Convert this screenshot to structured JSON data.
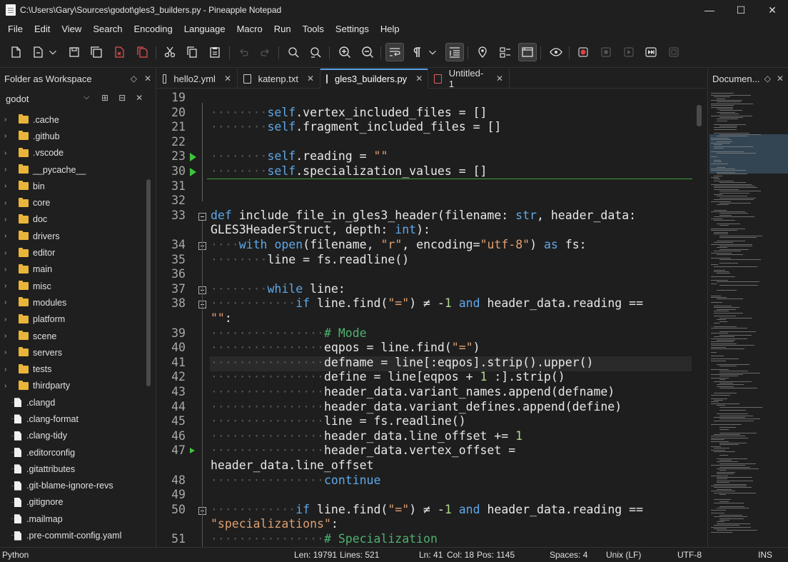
{
  "window": {
    "title": "C:\\Users\\Gary\\Sources\\godot\\gles3_builders.py - Pineapple Notepad",
    "minimize": "—",
    "maximize": "☐",
    "close": "✕"
  },
  "menu": [
    "File",
    "Edit",
    "View",
    "Search",
    "Encoding",
    "Language",
    "Macro",
    "Run",
    "Tools",
    "Settings",
    "Help"
  ],
  "left_panel": {
    "title": "Folder as Workspace",
    "folder": "godot",
    "tree": [
      {
        "name": ".cache",
        "type": "folder"
      },
      {
        "name": ".github",
        "type": "folder"
      },
      {
        "name": ".vscode",
        "type": "folder"
      },
      {
        "name": "__pycache__",
        "type": "folder"
      },
      {
        "name": "bin",
        "type": "folder"
      },
      {
        "name": "core",
        "type": "folder"
      },
      {
        "name": "doc",
        "type": "folder"
      },
      {
        "name": "drivers",
        "type": "folder"
      },
      {
        "name": "editor",
        "type": "folder"
      },
      {
        "name": "main",
        "type": "folder"
      },
      {
        "name": "misc",
        "type": "folder"
      },
      {
        "name": "modules",
        "type": "folder"
      },
      {
        "name": "platform",
        "type": "folder"
      },
      {
        "name": "scene",
        "type": "folder"
      },
      {
        "name": "servers",
        "type": "folder"
      },
      {
        "name": "tests",
        "type": "folder"
      },
      {
        "name": "thirdparty",
        "type": "folder"
      },
      {
        "name": ".clangd",
        "type": "file"
      },
      {
        "name": ".clang-format",
        "type": "file"
      },
      {
        "name": ".clang-tidy",
        "type": "file"
      },
      {
        "name": ".editorconfig",
        "type": "file"
      },
      {
        "name": ".gitattributes",
        "type": "file"
      },
      {
        "name": ".git-blame-ignore-revs",
        "type": "file"
      },
      {
        "name": ".gitignore",
        "type": "file"
      },
      {
        "name": ".mailmap",
        "type": "file"
      },
      {
        "name": ".pre-commit-config.yaml",
        "type": "file"
      }
    ]
  },
  "tabs": [
    {
      "label": "hello2.yml",
      "active": false,
      "unsaved": false
    },
    {
      "label": "katenp.txt",
      "active": false,
      "unsaved": false
    },
    {
      "label": "gles3_builders.py",
      "active": true,
      "unsaved": false
    },
    {
      "label": "Untitled-1",
      "active": false,
      "unsaved": true
    }
  ],
  "right_panel": {
    "title": "Documen..."
  },
  "status": {
    "language": "Python",
    "length": "Len: 19791",
    "lines": "Lines: 521",
    "line": "Ln: 41",
    "col": "Col: 18",
    "pos": "Pos: 1145",
    "spaces": "Spaces: 4",
    "eol": "Unix (LF)",
    "encoding": "UTF-8",
    "mode": "INS"
  },
  "code_lines": [
    {
      "num": "19",
      "text": ""
    },
    {
      "num": "20",
      "text": "        self.vertex_included_files = []"
    },
    {
      "num": "21",
      "text": "        self.fragment_included_files = []"
    },
    {
      "num": "22",
      "text": ""
    },
    {
      "num": "23",
      "text": "        self.reading = \"\""
    },
    {
      "num": "30",
      "text": "        self.specialization_values = []"
    },
    {
      "num": "31",
      "text": ""
    },
    {
      "num": "32",
      "text": ""
    },
    {
      "num": "33",
      "text": "def include_file_in_gles3_header(filename: str, header_data:"
    },
    {
      "num": "",
      "text": "GLES3HeaderStruct, depth: int):"
    },
    {
      "num": "34",
      "text": "    with open(filename, \"r\", encoding=\"utf-8\") as fs:"
    },
    {
      "num": "35",
      "text": "        line = fs.readline()"
    },
    {
      "num": "36",
      "text": ""
    },
    {
      "num": "37",
      "text": "        while line:"
    },
    {
      "num": "38",
      "text": "            if line.find(\"=\") ≠ -1 and header_data.reading =="
    },
    {
      "num": "",
      "text": "\"\":"
    },
    {
      "num": "39",
      "text": "                # Mode"
    },
    {
      "num": "40",
      "text": "                eqpos = line.find(\"=\")"
    },
    {
      "num": "41",
      "text": "                defname = line[:eqpos].strip().upper()"
    },
    {
      "num": "42",
      "text": "                define = line[eqpos + 1 :].strip()"
    },
    {
      "num": "43",
      "text": "                header_data.variant_names.append(defname)"
    },
    {
      "num": "44",
      "text": "                header_data.variant_defines.append(define)"
    },
    {
      "num": "45",
      "text": "                line = fs.readline()"
    },
    {
      "num": "46",
      "text": "                header_data.line_offset += 1"
    },
    {
      "num": "47",
      "text": "                header_data.vertex_offset ="
    },
    {
      "num": "",
      "text": "header_data.line_offset"
    },
    {
      "num": "48",
      "text": "                continue"
    },
    {
      "num": "49",
      "text": ""
    },
    {
      "num": "50",
      "text": "            if line.find(\"=\") ≠ -1 and header_data.reading =="
    },
    {
      "num": "",
      "text": "\"specializations\":"
    },
    {
      "num": "51",
      "text": "                # Specialization"
    }
  ]
}
